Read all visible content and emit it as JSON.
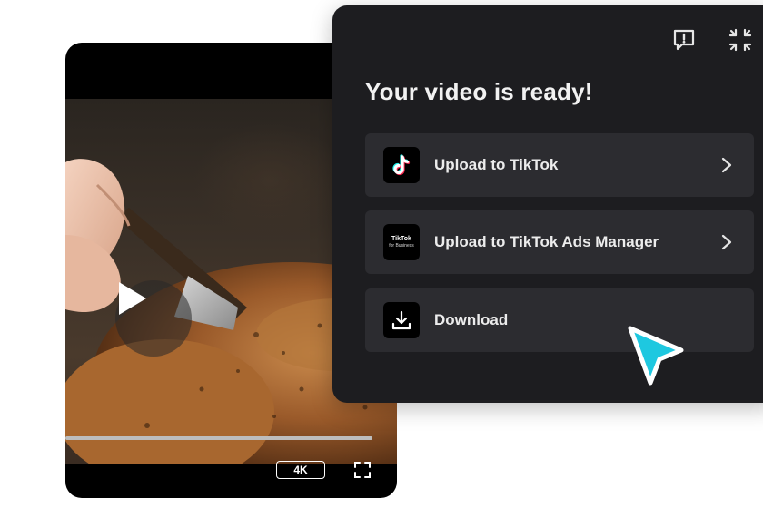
{
  "player": {
    "quality_label": "4K",
    "progress": 1.0
  },
  "panel": {
    "title": "Your video is ready!",
    "options": [
      {
        "label": "Upload to TikTok",
        "icon": "tiktok-logo-icon",
        "has_chevron": true
      },
      {
        "label": "Upload to TikTok Ads Manager",
        "icon": "tiktok-for-business-logo",
        "logo_text": "TikTok",
        "logo_subtext": "for Business",
        "has_chevron": true
      },
      {
        "label": "Download",
        "icon": "download-icon",
        "has_chevron": false
      }
    ]
  },
  "colors": {
    "panel_bg": "#1d1d20",
    "option_bg": "#2c2c30",
    "cursor": "#1ec8e0",
    "tiktok_cyan": "#25f4ee",
    "tiktok_red": "#fe2c55"
  }
}
